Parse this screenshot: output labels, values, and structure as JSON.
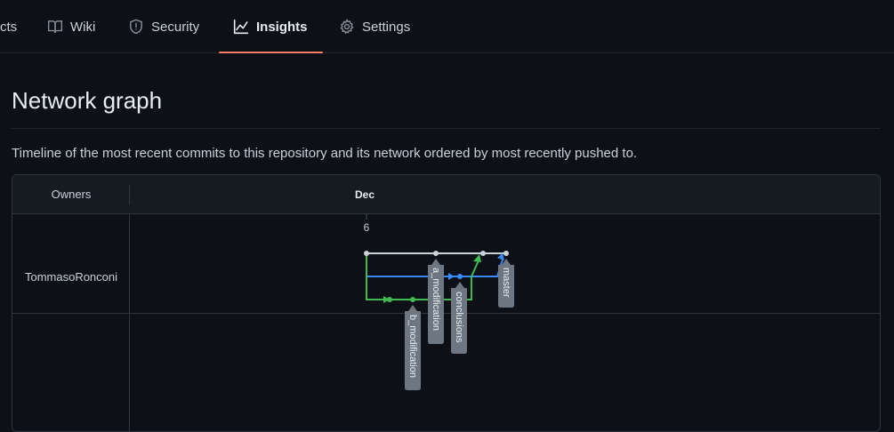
{
  "nav": {
    "items": [
      {
        "key": "projects",
        "label": "cts",
        "icon": "table-icon"
      },
      {
        "key": "wiki",
        "label": "Wiki",
        "icon": "book-icon"
      },
      {
        "key": "security",
        "label": "Security",
        "icon": "shield-icon"
      },
      {
        "key": "insights",
        "label": "Insights",
        "icon": "graph-icon",
        "active": true
      },
      {
        "key": "settings",
        "label": "Settings",
        "icon": "gear-icon"
      }
    ],
    "active_color": "#f78166"
  },
  "page": {
    "title": "Network graph",
    "subtitle": "Timeline of the most recent commits to this repository and its network ordered by most recently pushed to."
  },
  "graph": {
    "owners_header": "Owners",
    "month": "Dec",
    "day": "6",
    "owner": "TommasoRonconi",
    "branch_colors": {
      "master": "#c9d1d9",
      "a_modification": "#388bfd",
      "b_modification": "#3fb950"
    },
    "labels": {
      "a_modification": "a_modification",
      "conclusions": "conclusions",
      "master": "master",
      "b_modification": "b_modification"
    }
  }
}
